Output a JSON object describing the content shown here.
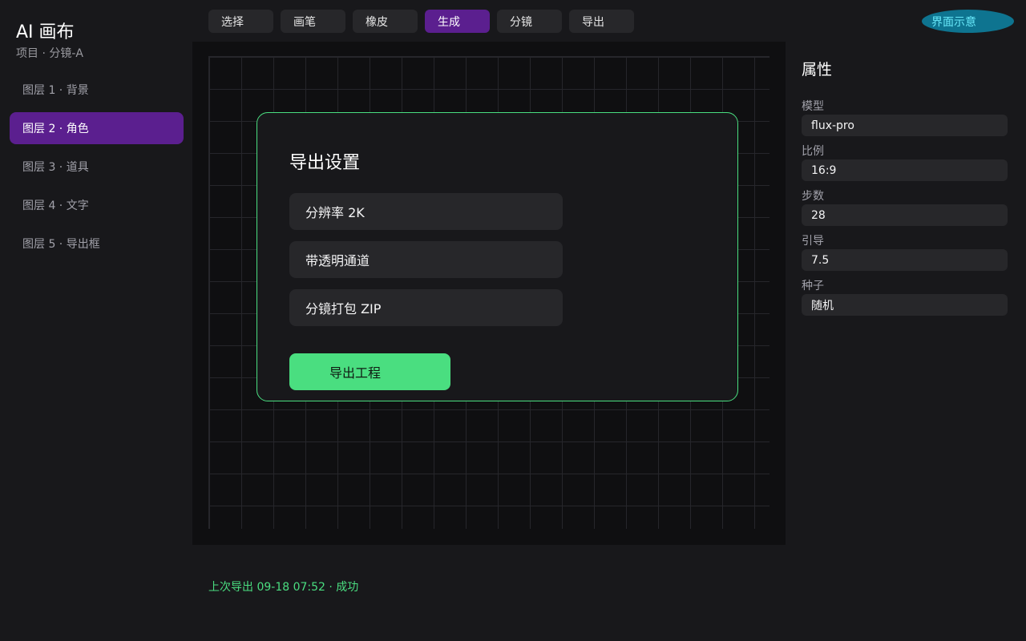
{
  "sidebar": {
    "app_title": "AI 画布",
    "project": "项目 · 分镜-A",
    "layers": [
      {
        "label": "图层 1 · 背景"
      },
      {
        "label": "图层 2 · 角色"
      },
      {
        "label": "图层 3 · 道具"
      },
      {
        "label": "图层 4 · 文字"
      },
      {
        "label": "图层 5 · 导出框"
      }
    ],
    "active_layer": "图层 2 · 角色"
  },
  "toolbar": {
    "tools": [
      {
        "label": "选择"
      },
      {
        "label": "画笔"
      },
      {
        "label": "橡皮"
      },
      {
        "label": "生成"
      },
      {
        "label": "分镜"
      },
      {
        "label": "导出"
      }
    ],
    "active_tool": "生成",
    "badge": "界面示意"
  },
  "dialog": {
    "title": "导出设置",
    "options": [
      {
        "label": "分辨率 2K"
      },
      {
        "label": "带透明通道"
      },
      {
        "label": "分镜打包 ZIP"
      }
    ],
    "primary_button": "导出工程"
  },
  "properties": {
    "title": "属性",
    "fields": [
      {
        "label": "模型",
        "value": "flux-pro"
      },
      {
        "label": "比例",
        "value": "16:9"
      },
      {
        "label": "步数",
        "value": "28"
      },
      {
        "label": "引导",
        "value": "7.5"
      },
      {
        "label": "种子",
        "value": "随机"
      }
    ]
  },
  "status": {
    "text": "上次导出 09-18 07:52 · 成功"
  },
  "colors": {
    "accent_purple": "#5b1f8f",
    "accent_green": "#4ade80",
    "badge_cyan": "#0e7490",
    "background": "#18181b",
    "canvas": "#0f0f11"
  }
}
